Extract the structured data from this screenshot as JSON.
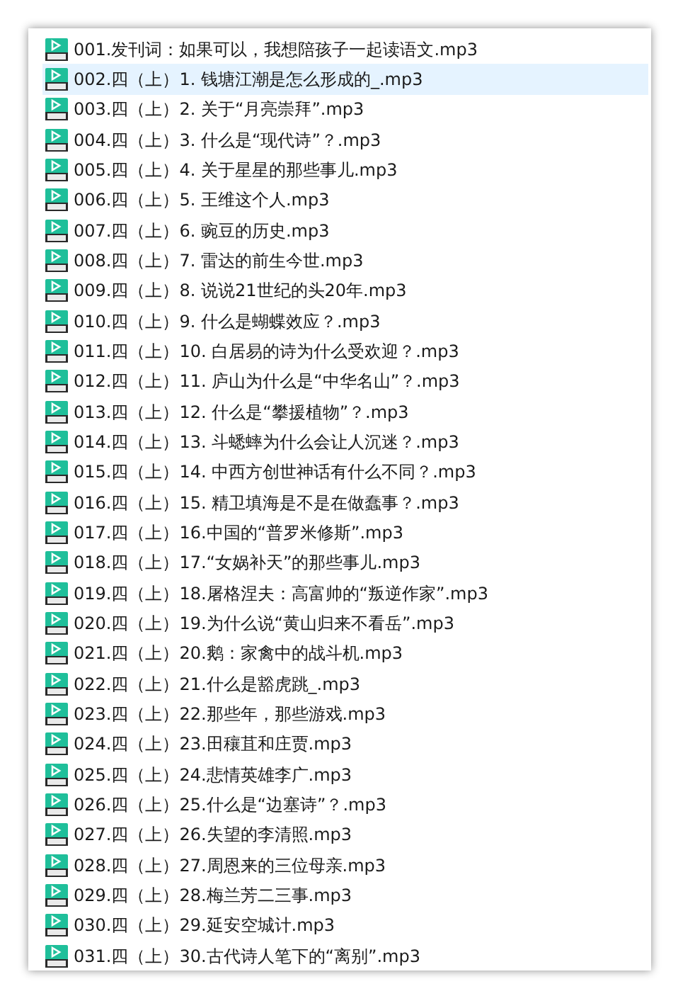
{
  "files": [
    {
      "name": "001.发刊词：如果可以，我想陪孩子一起读语文.mp3",
      "selected": false
    },
    {
      "name": "002.四（上）1. 钱塘江潮是怎么形成的_.mp3",
      "selected": true
    },
    {
      "name": "003.四（上）2. 关于“月亮崇拜”.mp3",
      "selected": false
    },
    {
      "name": "004.四（上）3. 什么是“现代诗”？.mp3",
      "selected": false
    },
    {
      "name": "005.四（上）4. 关于星星的那些事儿.mp3",
      "selected": false
    },
    {
      "name": "006.四（上）5. 王维这个人.mp3",
      "selected": false
    },
    {
      "name": "007.四（上）6. 豌豆的历史.mp3",
      "selected": false
    },
    {
      "name": "008.四（上）7. 雷达的前生今世.mp3",
      "selected": false
    },
    {
      "name": "009.四（上）8. 说说21世纪的头20年.mp3",
      "selected": false
    },
    {
      "name": "010.四（上）9. 什么是蝴蝶效应？.mp3",
      "selected": false
    },
    {
      "name": "011.四（上）10. 白居易的诗为什么受欢迎？.mp3",
      "selected": false
    },
    {
      "name": "012.四（上）11. 庐山为什么是“中华名山”？.mp3",
      "selected": false
    },
    {
      "name": "013.四（上）12. 什么是“攀援植物”？.mp3",
      "selected": false
    },
    {
      "name": "014.四（上）13. 斗蟋蟀为什么会让人沉迷？.mp3",
      "selected": false
    },
    {
      "name": "015.四（上）14. 中西方创世神话有什么不同？.mp3",
      "selected": false
    },
    {
      "name": "016.四（上）15. 精卫填海是不是在做蠢事？.mp3",
      "selected": false
    },
    {
      "name": "017.四（上）16.中国的“普罗米修斯”.mp3",
      "selected": false
    },
    {
      "name": "018.四（上）17.“女娲补天”的那些事儿.mp3",
      "selected": false
    },
    {
      "name": "019.四（上）18.屠格涅夫：高富帅的“叛逆作家”.mp3",
      "selected": false
    },
    {
      "name": "020.四（上）19.为什么说“黄山归来不看岳”.mp3",
      "selected": false
    },
    {
      "name": "021.四（上）20.鹅：家禽中的战斗机.mp3",
      "selected": false
    },
    {
      "name": "022.四（上）21.什么是豁虎跳_.mp3",
      "selected": false
    },
    {
      "name": "023.四（上）22.那些年，那些游戏.mp3",
      "selected": false
    },
    {
      "name": "024.四（上）23.田穰苴和庄贾.mp3",
      "selected": false
    },
    {
      "name": "025.四（上）24.悲情英雄李广.mp3",
      "selected": false
    },
    {
      "name": "026.四（上）25.什么是“边塞诗”？.mp3",
      "selected": false
    },
    {
      "name": "027.四（上）26.失望的李清照.mp3",
      "selected": false
    },
    {
      "name": "028.四（上）27.周恩来的三位母亲.mp3",
      "selected": false
    },
    {
      "name": "029.四（上）28.梅兰芳二三事.mp3",
      "selected": false
    },
    {
      "name": "030.四（上）29.延安空城计.mp3",
      "selected": false
    },
    {
      "name": "031.四（上）30.古代诗人笔下的“离别”.mp3",
      "selected": false
    }
  ]
}
